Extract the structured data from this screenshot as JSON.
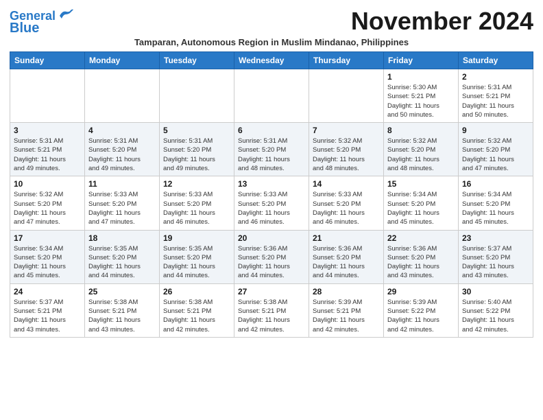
{
  "header": {
    "logo_line1": "General",
    "logo_line2": "Blue",
    "month_title": "November 2024"
  },
  "subtitle": "Tamparan, Autonomous Region in Muslim Mindanao, Philippines",
  "days_of_week": [
    "Sunday",
    "Monday",
    "Tuesday",
    "Wednesday",
    "Thursday",
    "Friday",
    "Saturday"
  ],
  "weeks": [
    [
      {
        "day": "",
        "content": ""
      },
      {
        "day": "",
        "content": ""
      },
      {
        "day": "",
        "content": ""
      },
      {
        "day": "",
        "content": ""
      },
      {
        "day": "",
        "content": ""
      },
      {
        "day": "1",
        "content": "Sunrise: 5:30 AM\nSunset: 5:21 PM\nDaylight: 11 hours\nand 50 minutes."
      },
      {
        "day": "2",
        "content": "Sunrise: 5:31 AM\nSunset: 5:21 PM\nDaylight: 11 hours\nand 50 minutes."
      }
    ],
    [
      {
        "day": "3",
        "content": "Sunrise: 5:31 AM\nSunset: 5:21 PM\nDaylight: 11 hours\nand 49 minutes."
      },
      {
        "day": "4",
        "content": "Sunrise: 5:31 AM\nSunset: 5:20 PM\nDaylight: 11 hours\nand 49 minutes."
      },
      {
        "day": "5",
        "content": "Sunrise: 5:31 AM\nSunset: 5:20 PM\nDaylight: 11 hours\nand 49 minutes."
      },
      {
        "day": "6",
        "content": "Sunrise: 5:31 AM\nSunset: 5:20 PM\nDaylight: 11 hours\nand 48 minutes."
      },
      {
        "day": "7",
        "content": "Sunrise: 5:32 AM\nSunset: 5:20 PM\nDaylight: 11 hours\nand 48 minutes."
      },
      {
        "day": "8",
        "content": "Sunrise: 5:32 AM\nSunset: 5:20 PM\nDaylight: 11 hours\nand 48 minutes."
      },
      {
        "day": "9",
        "content": "Sunrise: 5:32 AM\nSunset: 5:20 PM\nDaylight: 11 hours\nand 47 minutes."
      }
    ],
    [
      {
        "day": "10",
        "content": "Sunrise: 5:32 AM\nSunset: 5:20 PM\nDaylight: 11 hours\nand 47 minutes."
      },
      {
        "day": "11",
        "content": "Sunrise: 5:33 AM\nSunset: 5:20 PM\nDaylight: 11 hours\nand 47 minutes."
      },
      {
        "day": "12",
        "content": "Sunrise: 5:33 AM\nSunset: 5:20 PM\nDaylight: 11 hours\nand 46 minutes."
      },
      {
        "day": "13",
        "content": "Sunrise: 5:33 AM\nSunset: 5:20 PM\nDaylight: 11 hours\nand 46 minutes."
      },
      {
        "day": "14",
        "content": "Sunrise: 5:33 AM\nSunset: 5:20 PM\nDaylight: 11 hours\nand 46 minutes."
      },
      {
        "day": "15",
        "content": "Sunrise: 5:34 AM\nSunset: 5:20 PM\nDaylight: 11 hours\nand 45 minutes."
      },
      {
        "day": "16",
        "content": "Sunrise: 5:34 AM\nSunset: 5:20 PM\nDaylight: 11 hours\nand 45 minutes."
      }
    ],
    [
      {
        "day": "17",
        "content": "Sunrise: 5:34 AM\nSunset: 5:20 PM\nDaylight: 11 hours\nand 45 minutes."
      },
      {
        "day": "18",
        "content": "Sunrise: 5:35 AM\nSunset: 5:20 PM\nDaylight: 11 hours\nand 44 minutes."
      },
      {
        "day": "19",
        "content": "Sunrise: 5:35 AM\nSunset: 5:20 PM\nDaylight: 11 hours\nand 44 minutes."
      },
      {
        "day": "20",
        "content": "Sunrise: 5:36 AM\nSunset: 5:20 PM\nDaylight: 11 hours\nand 44 minutes."
      },
      {
        "day": "21",
        "content": "Sunrise: 5:36 AM\nSunset: 5:20 PM\nDaylight: 11 hours\nand 44 minutes."
      },
      {
        "day": "22",
        "content": "Sunrise: 5:36 AM\nSunset: 5:20 PM\nDaylight: 11 hours\nand 43 minutes."
      },
      {
        "day": "23",
        "content": "Sunrise: 5:37 AM\nSunset: 5:20 PM\nDaylight: 11 hours\nand 43 minutes."
      }
    ],
    [
      {
        "day": "24",
        "content": "Sunrise: 5:37 AM\nSunset: 5:21 PM\nDaylight: 11 hours\nand 43 minutes."
      },
      {
        "day": "25",
        "content": "Sunrise: 5:38 AM\nSunset: 5:21 PM\nDaylight: 11 hours\nand 43 minutes."
      },
      {
        "day": "26",
        "content": "Sunrise: 5:38 AM\nSunset: 5:21 PM\nDaylight: 11 hours\nand 42 minutes."
      },
      {
        "day": "27",
        "content": "Sunrise: 5:38 AM\nSunset: 5:21 PM\nDaylight: 11 hours\nand 42 minutes."
      },
      {
        "day": "28",
        "content": "Sunrise: 5:39 AM\nSunset: 5:21 PM\nDaylight: 11 hours\nand 42 minutes."
      },
      {
        "day": "29",
        "content": "Sunrise: 5:39 AM\nSunset: 5:22 PM\nDaylight: 11 hours\nand 42 minutes."
      },
      {
        "day": "30",
        "content": "Sunrise: 5:40 AM\nSunset: 5:22 PM\nDaylight: 11 hours\nand 42 minutes."
      }
    ]
  ]
}
